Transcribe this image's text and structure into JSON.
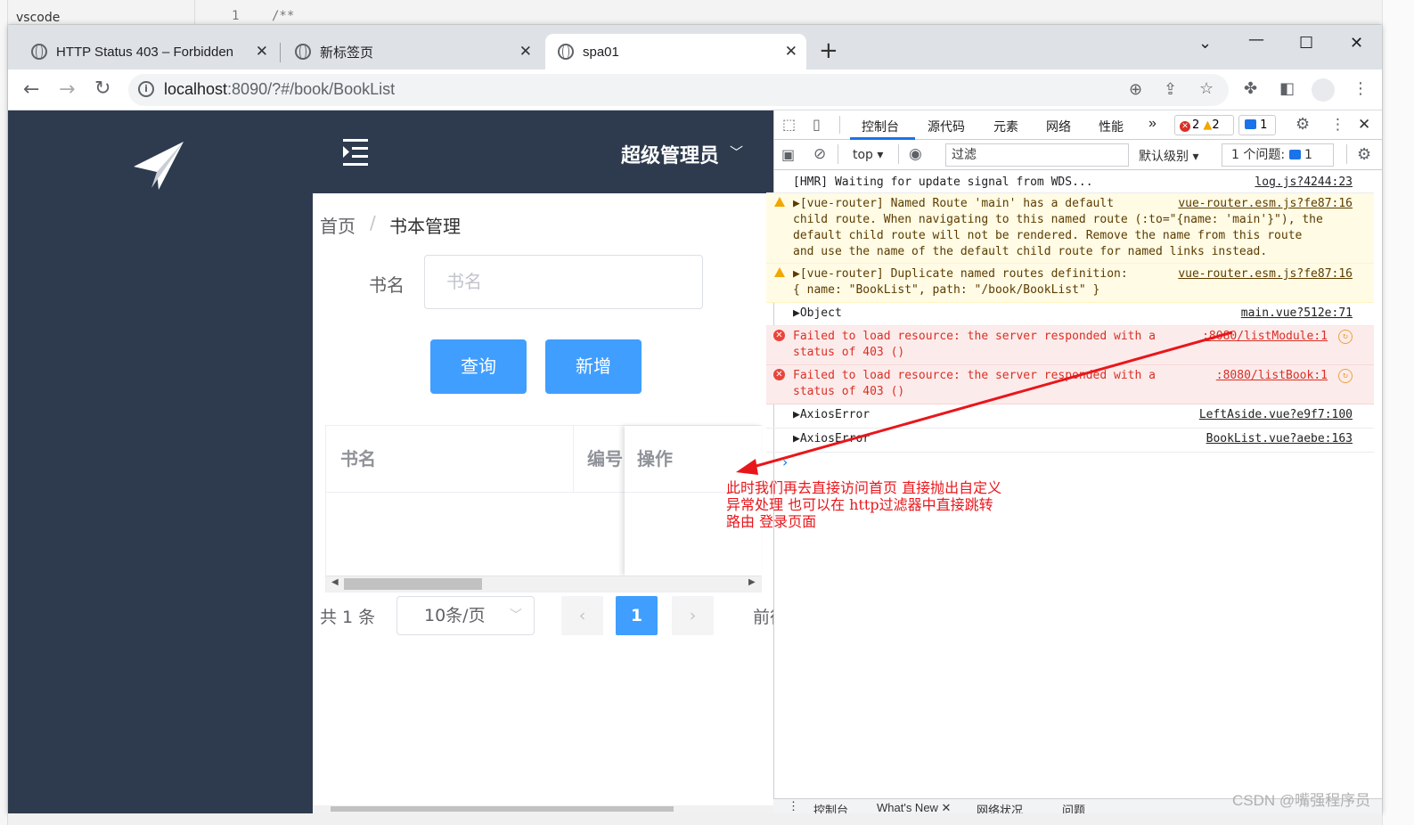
{
  "vscode": {
    "title": "vscode",
    "line_no": "1",
    "code": "/**"
  },
  "tabs": [
    {
      "title": "HTTP Status 403 – Forbidden"
    },
    {
      "title": "新标签页"
    },
    {
      "title": "spa01"
    }
  ],
  "new_tab": "+",
  "address": {
    "host": "localhost",
    "rest": ":8090/?#/book/BookList"
  },
  "app": {
    "user": "超级管理员",
    "breadcrumb": [
      "首页",
      "/",
      "书本管理"
    ],
    "search_label": "书名",
    "search_placeholder": "书名",
    "btn_query": "查询",
    "btn_add": "新增",
    "columns": [
      "书名",
      "编号",
      "操作"
    ],
    "pagination": {
      "total": "共 1 条",
      "page_size": "10条/页",
      "current": "1",
      "goto": "前往"
    }
  },
  "devtools": {
    "tabs": [
      "控制台",
      "源代码",
      "元素",
      "网络",
      "性能"
    ],
    "more": "»",
    "err_count": "2",
    "warn_count": "2",
    "info_count": "1",
    "context": "top",
    "filter_placeholder": "过滤",
    "level": "默认级别",
    "issues_label": "1 个问题:",
    "issues_count": "1",
    "messages": [
      {
        "text": "[HMR] Waiting for update signal from WDS...",
        "src": "log.js?4244:23"
      },
      {
        "text": "▶[vue-router] Named Route 'main' has a default\nchild route. When navigating to this named route (:to=\"{name: 'main'}\"), the\ndefault child route will not be rendered. Remove the name from this route\nand use the name of the default child route for named links instead.",
        "src": "vue-router.esm.js?fe87:16"
      },
      {
        "text": "▶[vue-router] Duplicate named routes definition:\n{ name: \"BookList\", path: \"/book/BookList\" }",
        "src": "vue-router.esm.js?fe87:16"
      },
      {
        "text": "▶Object",
        "src": "main.vue?512e:71"
      },
      {
        "text": "Failed to load resource: the server responded with a\nstatus of 403 ()",
        "src": ":8080/listModule:1"
      },
      {
        "text": "Failed to load resource: the server responded with a\nstatus of 403 ()",
        "src": ":8080/listBook:1"
      },
      {
        "text": "▶AxiosError",
        "src": "LeftAside.vue?e9f7:100"
      },
      {
        "text": "▶AxiosError",
        "src": "BookList.vue?aebe:163"
      }
    ],
    "prompt": "›",
    "drawer": [
      "控制台",
      "What's New ✕",
      "网络状况",
      "问题"
    ]
  },
  "annotation": "此时我们再去直接访问首页 直接抛出自定义\n异常处理 也可以在 http过滤器中直接跳转\n路由 登录页面",
  "watermark": "CSDN @嘴强程序员",
  "colors": {
    "aside": "#2e3b4e",
    "primary": "#409eff",
    "annotation": "#e8161b"
  }
}
